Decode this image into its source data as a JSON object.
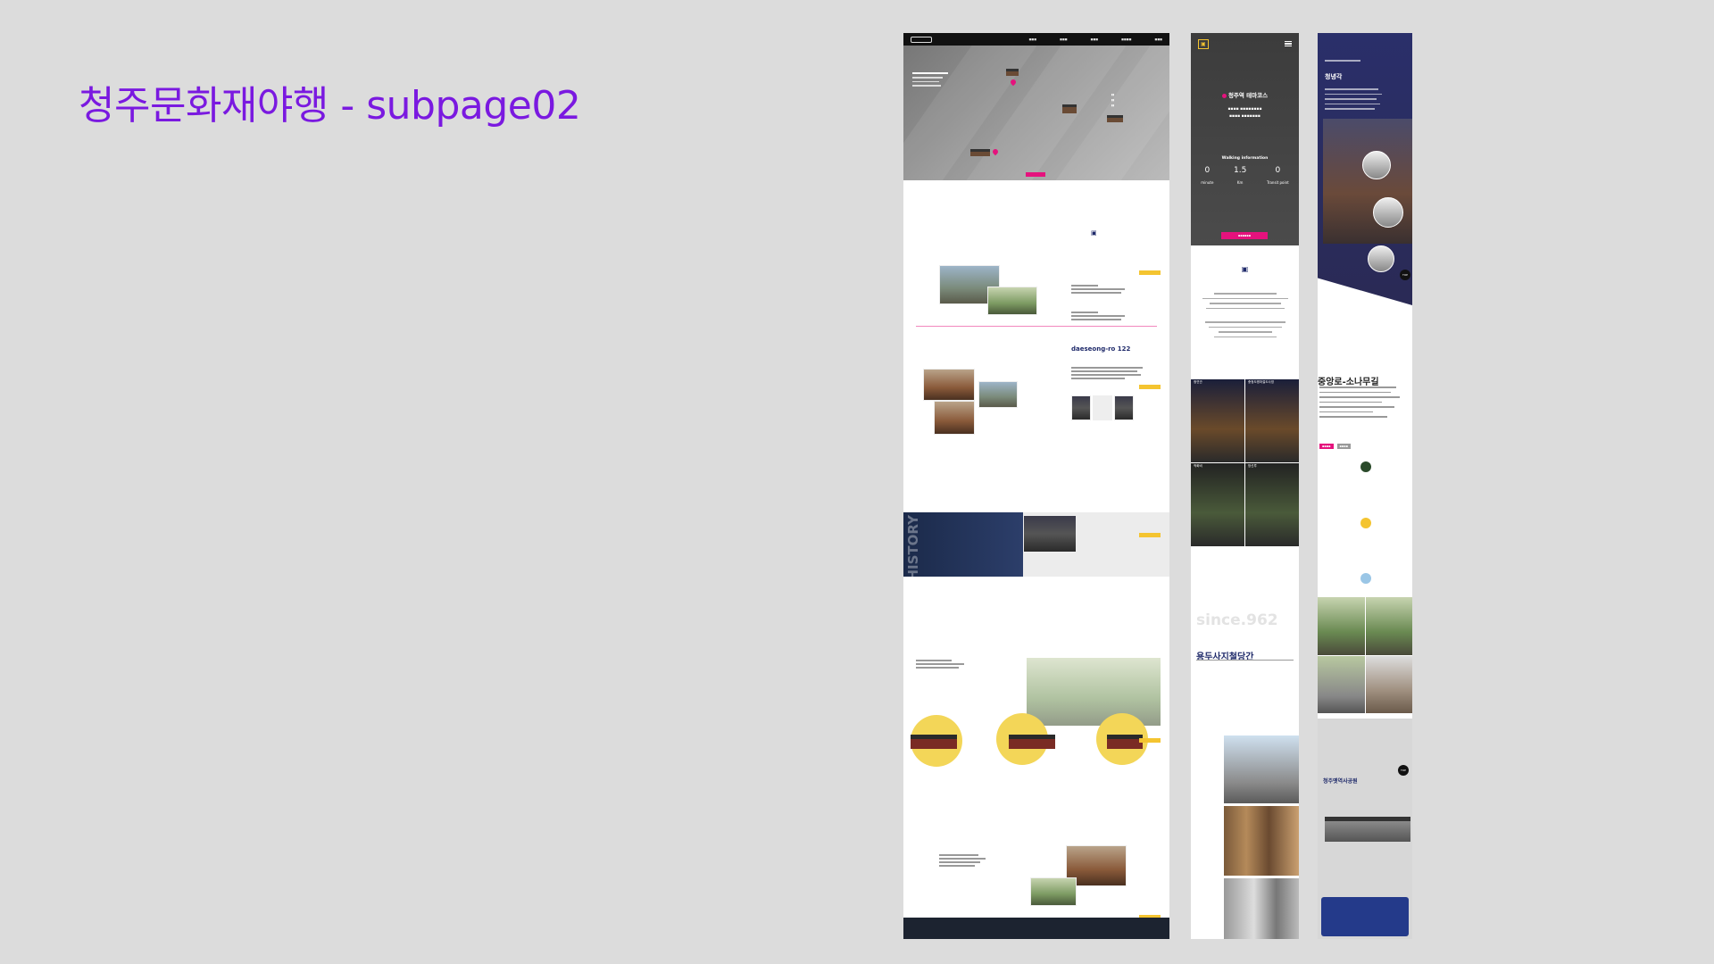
{
  "page": {
    "title": "청주문화재야행 - subpage02"
  },
  "colors": {
    "title": "#7a19e0",
    "accent_pink": "#e5127d",
    "accent_yellow": "#f4c430",
    "navy": "#1f2a6a",
    "background": "#dcdcdc"
  },
  "desktop": {
    "section_heading": "daeseong-ro 122",
    "history_word": "HISTORY"
  },
  "mobile1": {
    "course_title": "청주역 테마코스",
    "walking_label": "Walking information",
    "stats": [
      {
        "value": "0",
        "unit": "minute"
      },
      {
        "value": "1.5",
        "unit": "Km"
      },
      {
        "value": "0",
        "unit": "Transit point"
      }
    ],
    "grid_labels": [
      "청연관",
      "충청도병마절도사영",
      "척화비",
      "망선루"
    ],
    "since": "since.962",
    "heading": "용두사지철당간"
  },
  "mobile2": {
    "top_name": "청녕각",
    "heading": "중앙로-소나무길",
    "bottom_heading": "청주옛역사공원",
    "top_button": "TOP"
  }
}
